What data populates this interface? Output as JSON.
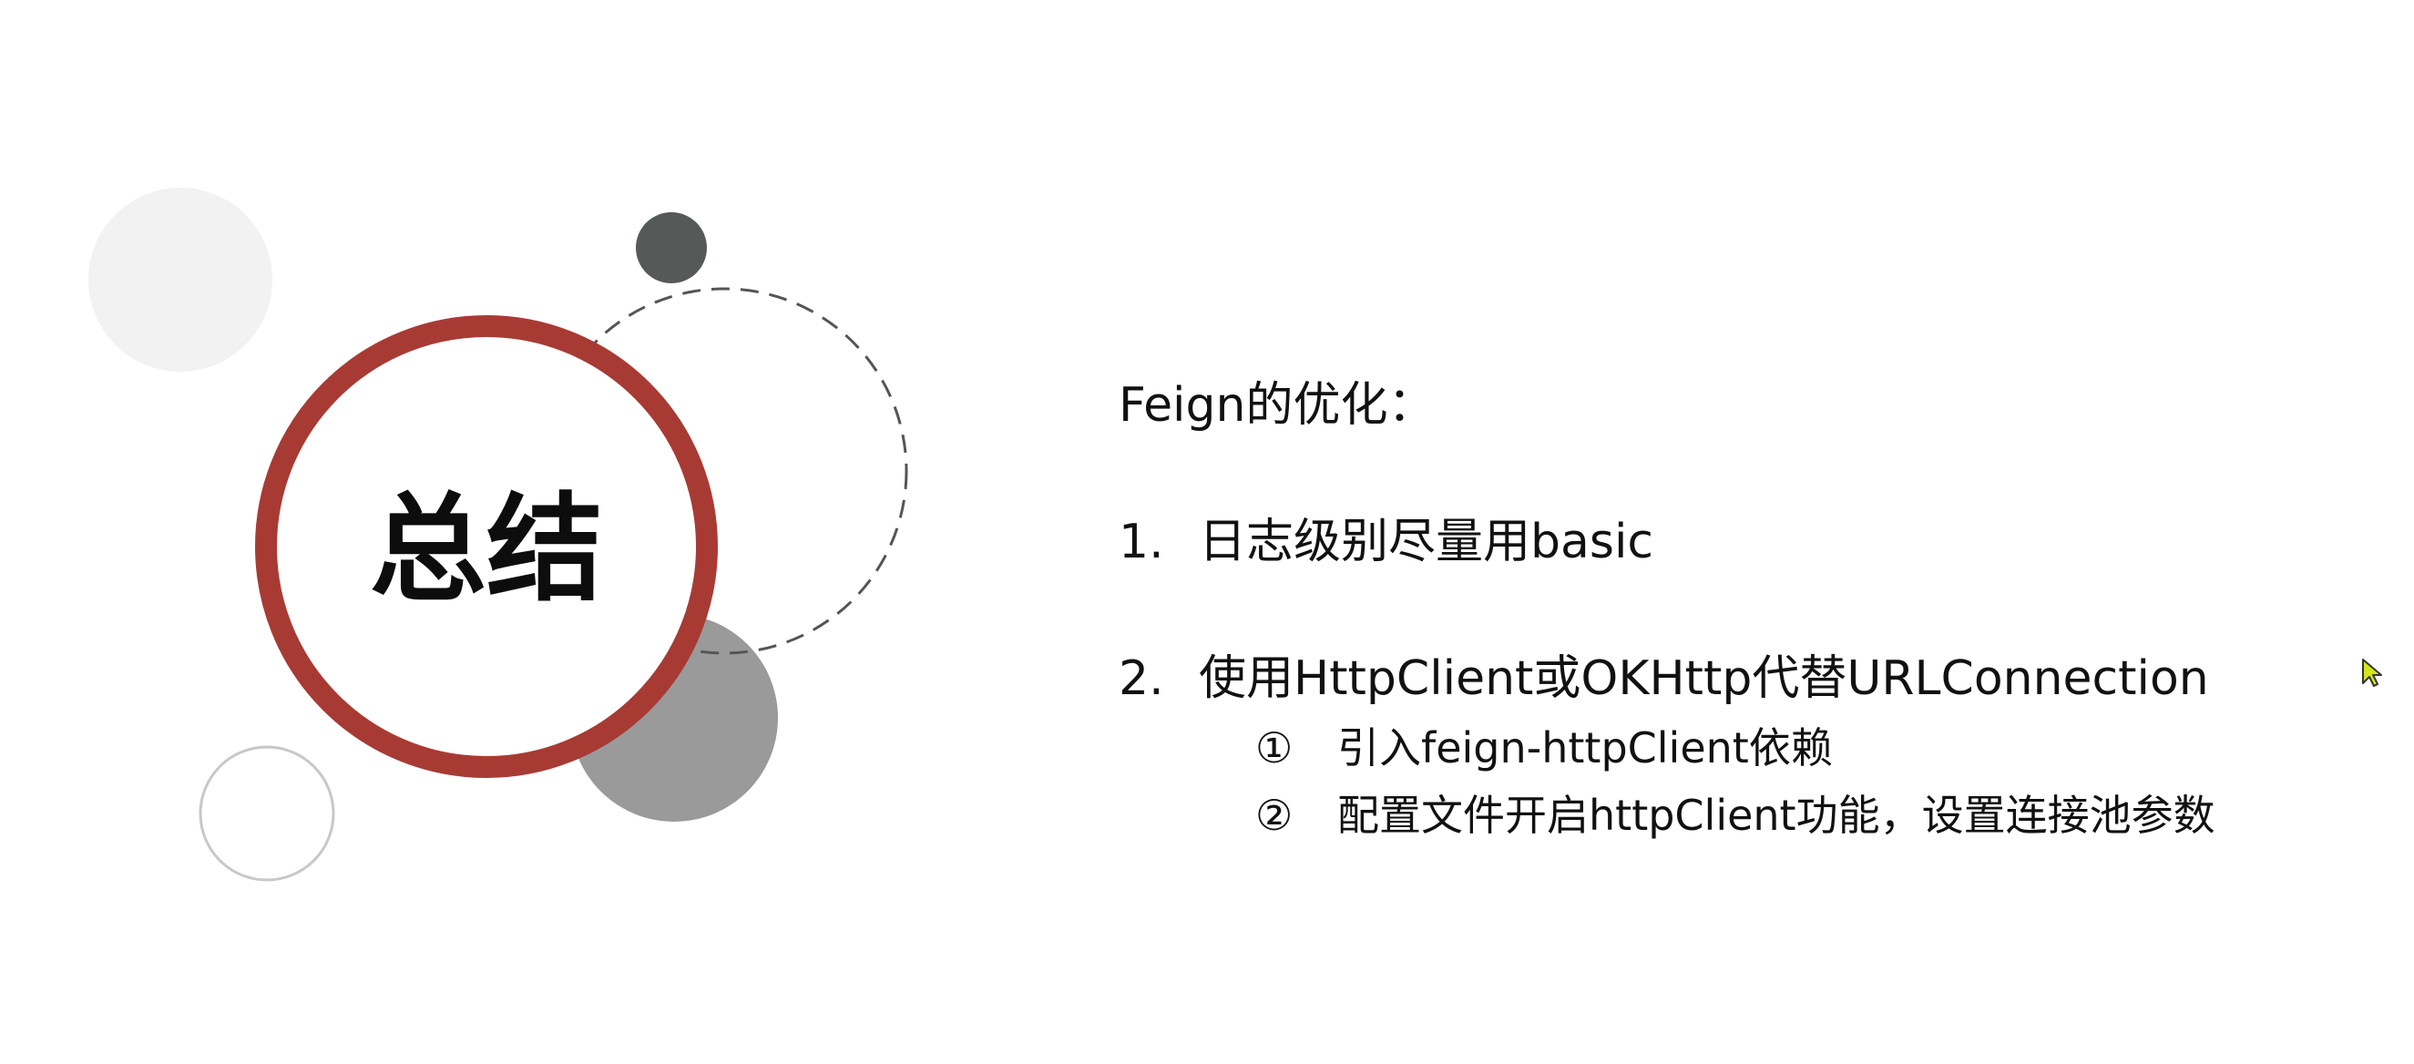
{
  "slide": {
    "title": "总结",
    "heading": "Feign的优化：",
    "items": [
      {
        "number": "1.",
        "text": "日志级别尽量用basic"
      },
      {
        "number": "2.",
        "text": "使用HttpClient或OKHttp代替URLConnection"
      }
    ],
    "subitems": [
      {
        "marker": "①",
        "text": "引入feign-httpClient依赖"
      },
      {
        "marker": "②",
        "text": "配置文件开启httpClient功能，设置连接池参数"
      }
    ]
  },
  "colors": {
    "ring": "#a83a34",
    "light_circle": "#f2f2f2",
    "dark_circle": "#555a58",
    "gray_circle": "#9a9a9a",
    "outline_circle": "#c8c8c8",
    "dashed_circle": "#555555",
    "cursor": "#d4e619"
  }
}
